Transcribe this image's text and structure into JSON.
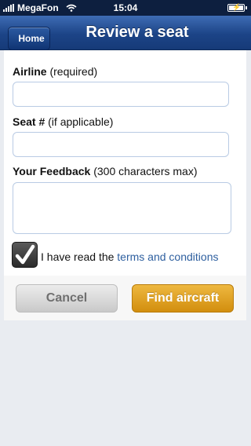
{
  "status_bar": {
    "carrier": "MegaFon",
    "time": "15:04",
    "icons": [
      "signal-icon",
      "wifi-icon",
      "battery-charging-icon"
    ]
  },
  "nav": {
    "back_label": "Home",
    "title": "Review a seat"
  },
  "form": {
    "airline": {
      "label": "Airline",
      "hint": "(required)",
      "value": "",
      "placeholder": ""
    },
    "seat": {
      "label": "Seat #",
      "hint": "(if applicable)",
      "value": "",
      "placeholder": ""
    },
    "feedback": {
      "label": "Your Feedback",
      "hint": "(300 characters max)",
      "value": "",
      "placeholder": ""
    },
    "terms": {
      "checked": true,
      "prefix": "I have read the",
      "link": "terms and conditions"
    }
  },
  "actions": {
    "cancel_label": "Cancel",
    "submit_label": "Find aircraft"
  },
  "colors": {
    "nav_blue": "#1c4487",
    "link_blue": "#2e5f9f",
    "submit_orange": "#e0a020",
    "cancel_gray": "#d8d8d8"
  }
}
